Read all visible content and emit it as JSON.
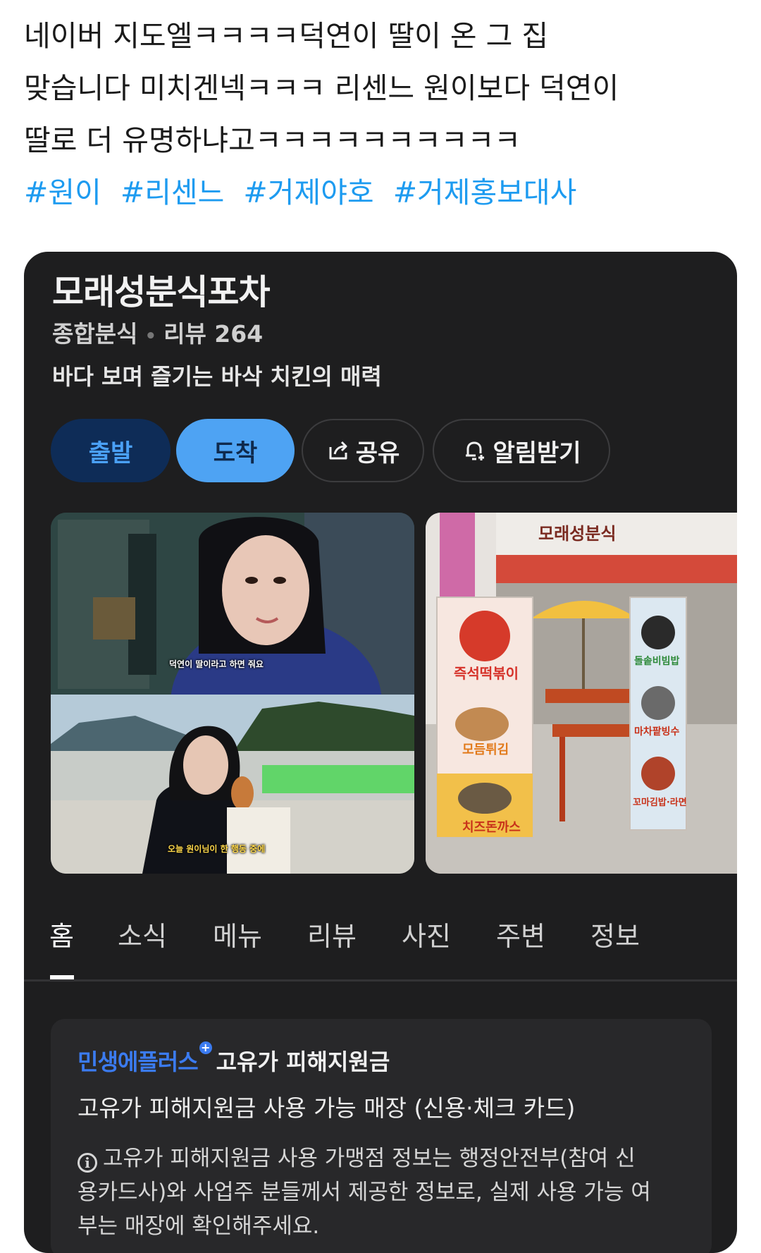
{
  "post": {
    "lines": [
      "네이버 지도엘ㅋㅋㅋㅋ덕연이 딸이 온 그 집",
      "맞습니다 미치겐넥ㅋㅋㅋ 리센느 원이보다 덕연이",
      "딸로 더 유명하냐고ㅋㅋㅋㅋㅋㅋㅋㅋㅋㅋ"
    ],
    "hashtags": [
      "#원이",
      "#리센느",
      "#거제야호",
      "#거제홍보대사"
    ]
  },
  "place": {
    "name": "모래성분식포차",
    "category": "종합분식",
    "review_label": "리뷰 264",
    "description": "바다 보며 즐기는 바삭 치킨의 매력"
  },
  "actions": {
    "depart": "출발",
    "arrive": "도착",
    "share": "공유",
    "alarm": "알림받기"
  },
  "photos": {
    "caption1": "덕연이 딸이라고 하면 줘요",
    "caption2": "오늘 원이님이 한 행동 중에",
    "sign_store": "모래성분식",
    "sign_left_1": "즉석떡볶이",
    "sign_left_2": "모듬튀김",
    "sign_left_3": "치즈돈까스",
    "sign_right_1": "돌솥비빔밥",
    "sign_right_2": "마차팥빙수",
    "sign_right_3": "꼬마김밥·라면"
  },
  "tabs": [
    "홈",
    "소식",
    "메뉴",
    "리뷰",
    "사진",
    "주변",
    "정보"
  ],
  "notice": {
    "brand": "민생에플러스",
    "title": "고유가 피해지원금",
    "subtitle": "고유가 피해지원금 사용 가능 매장 (신용·체크 카드)",
    "body": "고유가 피해지원금 사용 가맹점 정보는 행정안전부(참여 신용카드사)와 사업주 분들께서 제공한 정보로, 실제 사용 가능 여부는 매장에 확인해주세요."
  },
  "colors": {
    "hashtag": "#1d9bf0",
    "card_bg": "#1e1e1f",
    "depart_bg": "#0e2c57",
    "arrive_bg": "#4ea3f3",
    "brand_blue": "#3b7bf0"
  }
}
